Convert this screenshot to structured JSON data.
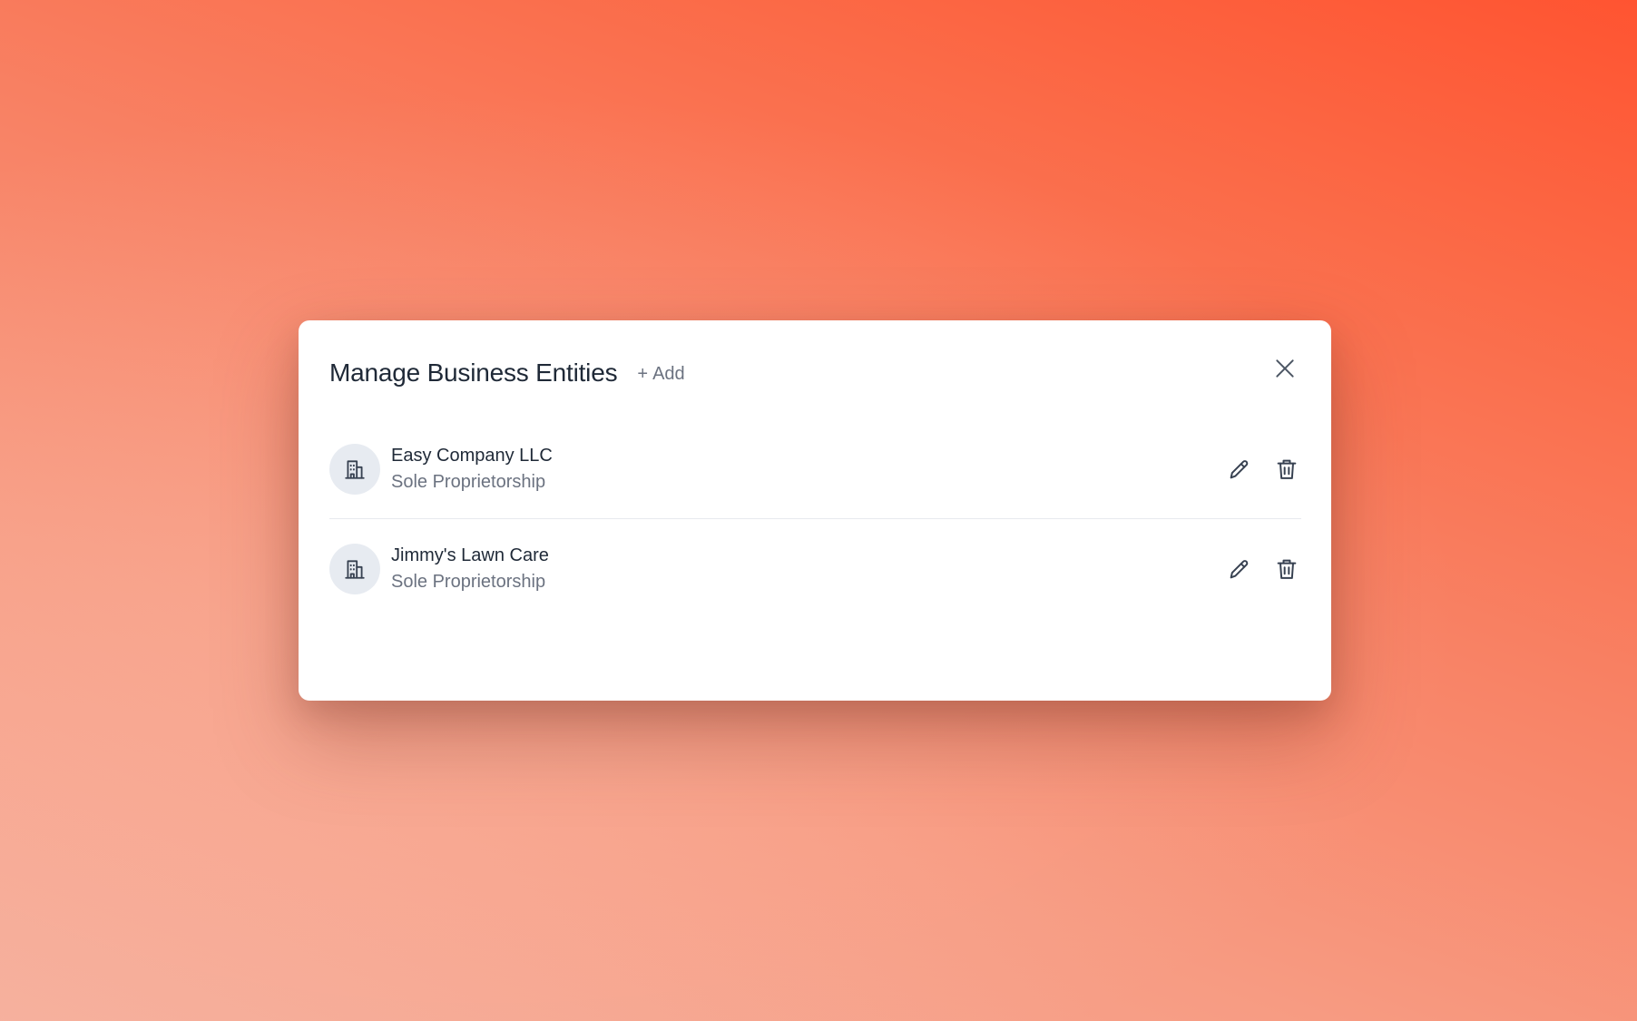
{
  "modal": {
    "title": "Manage Business Entities",
    "add_plus": "+",
    "add_label": "Add"
  },
  "icons": {
    "close": "close-icon",
    "entity": "building-icon",
    "edit": "pencil-icon",
    "delete": "trash-icon"
  },
  "colors": {
    "background_start": "#f6b09d",
    "background_end": "#ff5431",
    "title_text": "#1f2937",
    "secondary_text": "#6b7280",
    "icon": "#374151",
    "avatar_bg": "#e7ebf1"
  },
  "entities": [
    {
      "name": "Easy Company LLC",
      "type": "Sole Proprietorship"
    },
    {
      "name": "Jimmy's Lawn Care",
      "type": "Sole Proprietorship"
    }
  ]
}
